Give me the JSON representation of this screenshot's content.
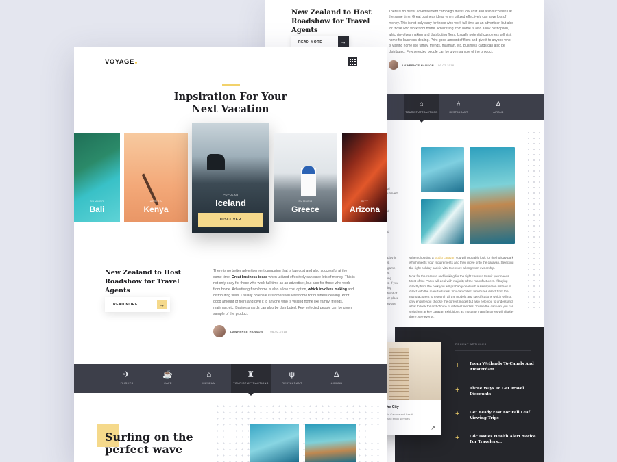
{
  "colors": {
    "accent": "#f5d98b",
    "dark": "#2b2c33",
    "nav": "#3d3f4a"
  },
  "back": {
    "article_title": "New Zealand to Host Roadshow for Travel Agents",
    "read_more": "READ MORE",
    "paragraph": "There is no better advertisement campaign that is low cost and also successful at the same time. Great business ideas when utilized effectively can save lots of money. This is not only easy for those who work full-time as an advertiser, but also for those who work from home. Advertising from home is also a low cost option, which involves making and distributing fliers. Usually potential customers will visit home for business dealing. Print good amount of fliers and give it to anyone who is visiting home like family, friends, mailman, etc. Business cards can also be distributed. Few selected people can be given sample of the product.",
    "author": "LAWRENCE HANSON",
    "date": "06-02-2018",
    "nav": [
      {
        "icon": "tourist-attractions-icon",
        "label": "TOURIST ATTRACTIONS"
      },
      {
        "icon": "restaurant-icon",
        "label": "RESTAURANT"
      },
      {
        "icon": "airbnb-icon",
        "label": "AIRBNB"
      }
    ],
    "paragraph2_pre": "When choosing a ",
    "paragraph2_link": "studio caravan",
    "paragraph2_post": " you will probably look for the holiday park which meets your requirements and then move onto the caravan. Selecting the right holiday park is vital to ensure a long-term ownership.",
    "paragraph3": "Now for the caravan and looking for the right caravan to suit your needs. Most of the Parks will deal with majority of the manufacturers. If buying directly from the park you will probably deal with a salesperson instead of direct with the manufacturers. You can collect brochures direct from the manufacturers to research all the models and specifications which will not only ensure you choose the correct model but also help you to understand what to look for and choice of different models. To see the caravan you can visit them at key caravan exhibitions as most top manufacturers will display there, see events.",
    "card_title": "me in the City",
    "card_text": "is located in Canada and has it many ways to enjoy services range",
    "recent_heading": "RECENT ARTICLES",
    "recent": [
      "From Wetlands To Canals And Amsterdam ...",
      "Three Ways To Get Travel Discounts",
      "Get Ready Fast For Fall Leaf Viewing Trips",
      "Cdc Issues Health Alert Notice For Travelers..."
    ]
  },
  "front": {
    "logo": "VOYAGE",
    "hero_title_line1": "Inpsiration For Your",
    "hero_title_line2": "Next Vacation",
    "destinations": [
      {
        "category": "SUMMER",
        "name": "Bali"
      },
      {
        "category": "AFRICA",
        "name": "Kenya"
      },
      {
        "category": "POPULAR",
        "name": "Iceland"
      },
      {
        "category": "SUMMER",
        "name": "Greece"
      },
      {
        "category": "CITY",
        "name": "Arizona"
      }
    ],
    "discover": "DISCOVER",
    "article_title": "New Zealand to Host Roadshow for Travel Agents",
    "read_more": "READ MORE",
    "para_part1": "There is no better advertisement campaign that is low cost and also successful at the same time. ",
    "para_bold1": "Great business ideas",
    "para_part2": " when utilized effectively can save lots of money. This is not only easy for those who work full-time as an advertiser, but also for those who work from home. Advertising from home is also a low cost option, ",
    "para_bold2": "which involves making",
    "para_part3": " and distributing fliers. Usually potential customers will visit home for business dealing. Print good amount of fliers and give it to anyone who is visiting home like family, friends, mailman, etc. Business cards can also be distributed. Few selected people can be given sample of the product.",
    "author": "LAWRENCE HANSON",
    "date": "06-02-2018",
    "nav": [
      {
        "icon": "flights-icon",
        "label": "FLIGHTS"
      },
      {
        "icon": "cafe-icon",
        "label": "CAFE"
      },
      {
        "icon": "museum-icon",
        "label": "MUSEUM"
      },
      {
        "icon": "tourist-attractions-icon",
        "label": "TOURIST ATTRACTIONS"
      },
      {
        "icon": "restaurant-icon",
        "label": "RESTAURANT"
      },
      {
        "icon": "airbnb-icon",
        "label": "AIRBNB"
      }
    ],
    "surf_title": "Surfing on the perfect wave"
  }
}
